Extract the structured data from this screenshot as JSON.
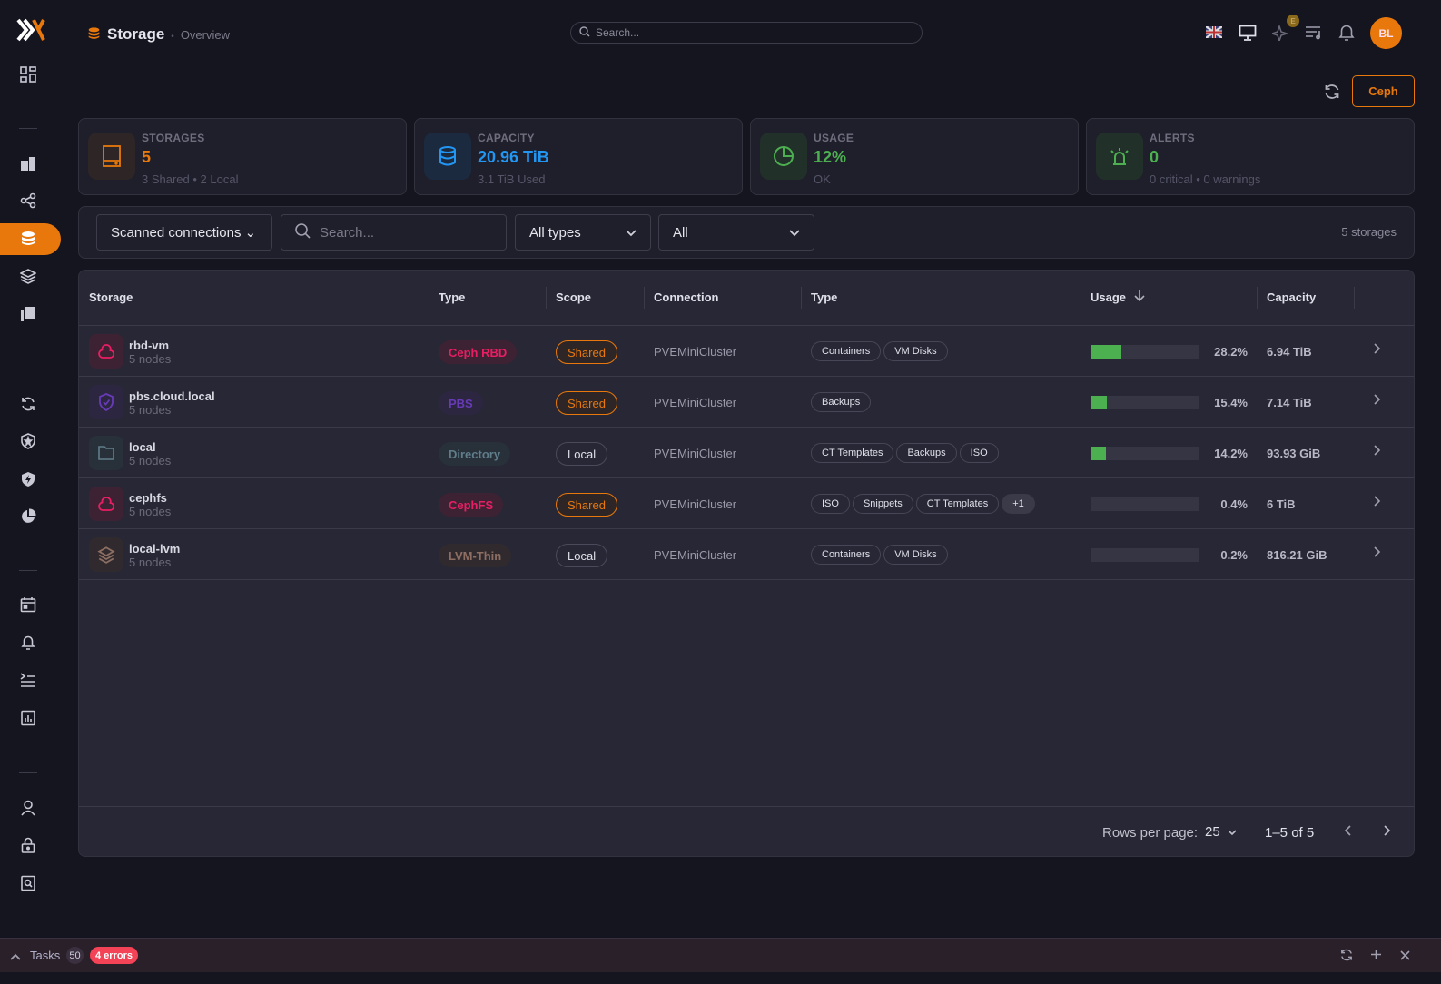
{
  "header": {
    "title": "Storage",
    "breadcrumb": "Overview",
    "search_placeholder": "Search...",
    "avatar": "BL",
    "ai_badge": "E"
  },
  "actions": {
    "ceph_label": "Ceph"
  },
  "stats": [
    {
      "label": "STORAGES",
      "value": "5",
      "sub": "3 Shared • 2 Local",
      "color": "#e8780c"
    },
    {
      "label": "CAPACITY",
      "value": "20.96 TiB",
      "sub": "3.1 TiB Used",
      "color": "#2196f3"
    },
    {
      "label": "USAGE",
      "value": "12%",
      "sub": "OK",
      "color": "#4caf50"
    },
    {
      "label": "ALERTS",
      "value": "0",
      "sub": "0 critical • 0 warnings",
      "color": "#4caf50"
    }
  ],
  "filters": {
    "connections": "Scanned connections",
    "search_placeholder": "Search...",
    "types": "All types",
    "scope": "All",
    "count": "5 storages"
  },
  "table": {
    "columns": [
      "Storage",
      "Type",
      "Scope",
      "Connection",
      "Type",
      "Usage",
      "Capacity"
    ],
    "rows": [
      {
        "name": "rbd-vm",
        "nodes": "5 nodes",
        "icon": "cloud",
        "type": "Ceph RBD",
        "type_color": "#e91e63",
        "type_bg": "#3d2233",
        "scope": "Shared",
        "connection": "PVEMiniCluster",
        "content": [
          "Containers",
          "VM Disks"
        ],
        "usage": 28.2,
        "usage_text": "28.2%",
        "capacity": "6.94 TiB"
      },
      {
        "name": "pbs.cloud.local",
        "nodes": "5 nodes",
        "icon": "shield",
        "type": "PBS",
        "type_color": "#673ab7",
        "type_bg": "#2c2640",
        "scope": "Shared",
        "connection": "PVEMiniCluster",
        "content": [
          "Backups"
        ],
        "usage": 15.4,
        "usage_text": "15.4%",
        "capacity": "7.14 TiB"
      },
      {
        "name": "local",
        "nodes": "5 nodes",
        "icon": "folder",
        "type": "Directory",
        "type_color": "#5f7d8a",
        "type_bg": "#28303a",
        "scope": "Local",
        "connection": "PVEMiniCluster",
        "content": [
          "CT Templates",
          "Backups",
          "ISO"
        ],
        "usage": 14.2,
        "usage_text": "14.2%",
        "capacity": "93.93 GiB"
      },
      {
        "name": "cephfs",
        "nodes": "5 nodes",
        "icon": "cloud",
        "type": "CephFS",
        "type_color": "#e91e63",
        "type_bg": "#3d2233",
        "scope": "Shared",
        "connection": "PVEMiniCluster",
        "content": [
          "ISO",
          "Snippets",
          "CT Templates",
          "+1"
        ],
        "usage": 0.4,
        "usage_text": "0.4%",
        "capacity": "6 TiB"
      },
      {
        "name": "local-lvm",
        "nodes": "5 nodes",
        "icon": "layers",
        "type": "LVM-Thin",
        "type_color": "#8d6e63",
        "type_bg": "#302a2e",
        "scope": "Local",
        "connection": "PVEMiniCluster",
        "content": [
          "Containers",
          "VM Disks"
        ],
        "usage": 0.2,
        "usage_text": "0.2%",
        "capacity": "816.21 GiB"
      }
    ]
  },
  "pagination": {
    "rows_label": "Rows per page:",
    "rows_value": "25",
    "range": "1–5 of 5"
  },
  "tasks": {
    "label": "Tasks",
    "count": "50",
    "errors": "4 errors"
  }
}
